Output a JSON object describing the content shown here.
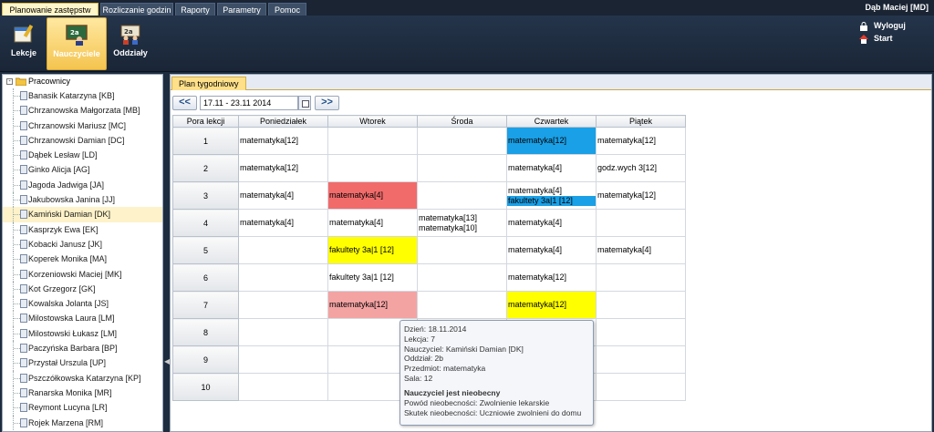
{
  "menu": {
    "tabs": [
      {
        "label": "Planowanie zastępstw",
        "active": true
      },
      {
        "label": "Rozliczanie godzin",
        "active": false
      },
      {
        "label": "Raporty",
        "active": false
      },
      {
        "label": "Parametry",
        "active": false
      },
      {
        "label": "Pomoc",
        "active": false
      }
    ],
    "user": "Dąb Maciej [MD]"
  },
  "toolbar": {
    "buttons": [
      {
        "label": "Lekcje",
        "icon": "lessons-icon",
        "active": false
      },
      {
        "label": "Nauczyciele",
        "icon": "teachers-icon",
        "active": true
      },
      {
        "label": "Oddziały",
        "icon": "classes-icon",
        "active": false
      }
    ],
    "logout": "Wyloguj",
    "start": "Start"
  },
  "tree": {
    "root": "Pracownicy",
    "items": [
      "Banasik Katarzyna [KB]",
      "Chrzanowska Małgorzata [MB]",
      "Chrzanowski Mariusz [MC]",
      "Chrzanowski Damian [DC]",
      "Dąbek Lesław [LD]",
      "Ginko Alicja [AG]",
      "Jagoda Jadwiga [JA]",
      "Jakubowska Janina [JJ]",
      "Kamiński Damian [DK]",
      "Kasprzyk Ewa [EK]",
      "Kobacki Janusz [JK]",
      "Koperek Monika [MA]",
      "Korzeniowski Maciej [MK]",
      "Kot Grzegorz [GK]",
      "Kowalska Jolanta [JS]",
      "Milostowska Laura [LM]",
      "Milostowski Łukasz [LM]",
      "Paczyńska Barbara [BP]",
      "Przystał Urszula [UP]",
      "Pszczółkowska Katarzyna [KP]",
      "Ranarska Monika [MR]",
      "Reymont Lucyna [LR]",
      "Rojek Marzena [RM]"
    ],
    "selected_index": 8
  },
  "tab": {
    "label": "Plan tygodniowy"
  },
  "nav": {
    "prev": "<<",
    "next": ">>",
    "date_range": "17.11 - 23.11 2014"
  },
  "schedule": {
    "headers": [
      "Pora lekcji",
      "Poniedziałek",
      "Wtorek",
      "Środa",
      "Czwartek",
      "Piątek"
    ],
    "rows": [
      {
        "n": "1",
        "cells": [
          {
            "lines": [
              "matematyka[12]"
            ]
          },
          {
            "lines": []
          },
          {
            "lines": []
          },
          {
            "lines": [
              "matematyka[12]"
            ],
            "color": "blue"
          },
          {
            "lines": [
              "matematyka[12]"
            ]
          }
        ]
      },
      {
        "n": "2",
        "cells": [
          {
            "lines": [
              "matematyka[12]"
            ]
          },
          {
            "lines": []
          },
          {
            "lines": []
          },
          {
            "lines": [
              "matematyka[4]"
            ]
          },
          {
            "lines": [
              "godz.wych 3[12]"
            ]
          }
        ]
      },
      {
        "n": "3",
        "cells": [
          {
            "lines": [
              "matematyka[4]"
            ]
          },
          {
            "lines": [
              "matematyka[4]"
            ],
            "color": "red"
          },
          {
            "lines": []
          },
          {
            "lines": [
              "matematyka[4]",
              "fakultety 3a|1 [12]"
            ],
            "bar": 1
          },
          {
            "lines": [
              "matematyka[12]"
            ]
          }
        ]
      },
      {
        "n": "4",
        "cells": [
          {
            "lines": [
              "matematyka[4]"
            ]
          },
          {
            "lines": [
              "matematyka[4]"
            ]
          },
          {
            "lines": [
              "matematyka[13]",
              "matematyka[10]"
            ]
          },
          {
            "lines": [
              "matematyka[4]"
            ]
          },
          {
            "lines": []
          }
        ]
      },
      {
        "n": "5",
        "cells": [
          {
            "lines": []
          },
          {
            "lines": [
              "fakultety 3a|1 [12]"
            ],
            "color": "yellow"
          },
          {
            "lines": []
          },
          {
            "lines": [
              "matematyka[4]"
            ]
          },
          {
            "lines": [
              "matematyka[4]"
            ]
          }
        ]
      },
      {
        "n": "6",
        "cells": [
          {
            "lines": []
          },
          {
            "lines": [
              "fakultety 3a|1 [12]"
            ]
          },
          {
            "lines": []
          },
          {
            "lines": [
              "matematyka[12]"
            ]
          },
          {
            "lines": []
          }
        ]
      },
      {
        "n": "7",
        "cells": [
          {
            "lines": []
          },
          {
            "lines": [
              "matematyka[12]"
            ],
            "color": "pink"
          },
          {
            "lines": []
          },
          {
            "lines": [
              "matematyka[12]"
            ],
            "color": "yellow"
          },
          {
            "lines": []
          }
        ]
      },
      {
        "n": "8",
        "cells": [
          {
            "lines": []
          },
          {
            "lines": []
          },
          {
            "lines": []
          },
          {
            "lines": []
          },
          {
            "lines": []
          }
        ]
      },
      {
        "n": "9",
        "cells": [
          {
            "lines": []
          },
          {
            "lines": []
          },
          {
            "lines": []
          },
          {
            "lines": []
          },
          {
            "lines": []
          }
        ]
      },
      {
        "n": "10",
        "cells": [
          {
            "lines": []
          },
          {
            "lines": []
          },
          {
            "lines": []
          },
          {
            "lines": []
          },
          {
            "lines": []
          }
        ]
      }
    ]
  },
  "tooltip": {
    "lines": [
      "Dzień: 18.11.2014",
      "Lekcja: 7",
      "Nauczyciel: Kamiński Damian [DK]",
      "Oddział: 2b",
      "Przedmiot: matematyka",
      "Sala: 12"
    ],
    "heading": "Nauczyciel jest nieobecny",
    "reason": "Powód nieobecności: Zwolnienie lekarskie",
    "effect": "Skutek nieobecności: Uczniowie zwolnieni do domu"
  },
  "colors": {
    "red": "#f26b6b",
    "pink": "#f4a3a3",
    "yellow": "#ffff00",
    "blue": "#1aa0e6",
    "selected": "#fdf2c9"
  }
}
